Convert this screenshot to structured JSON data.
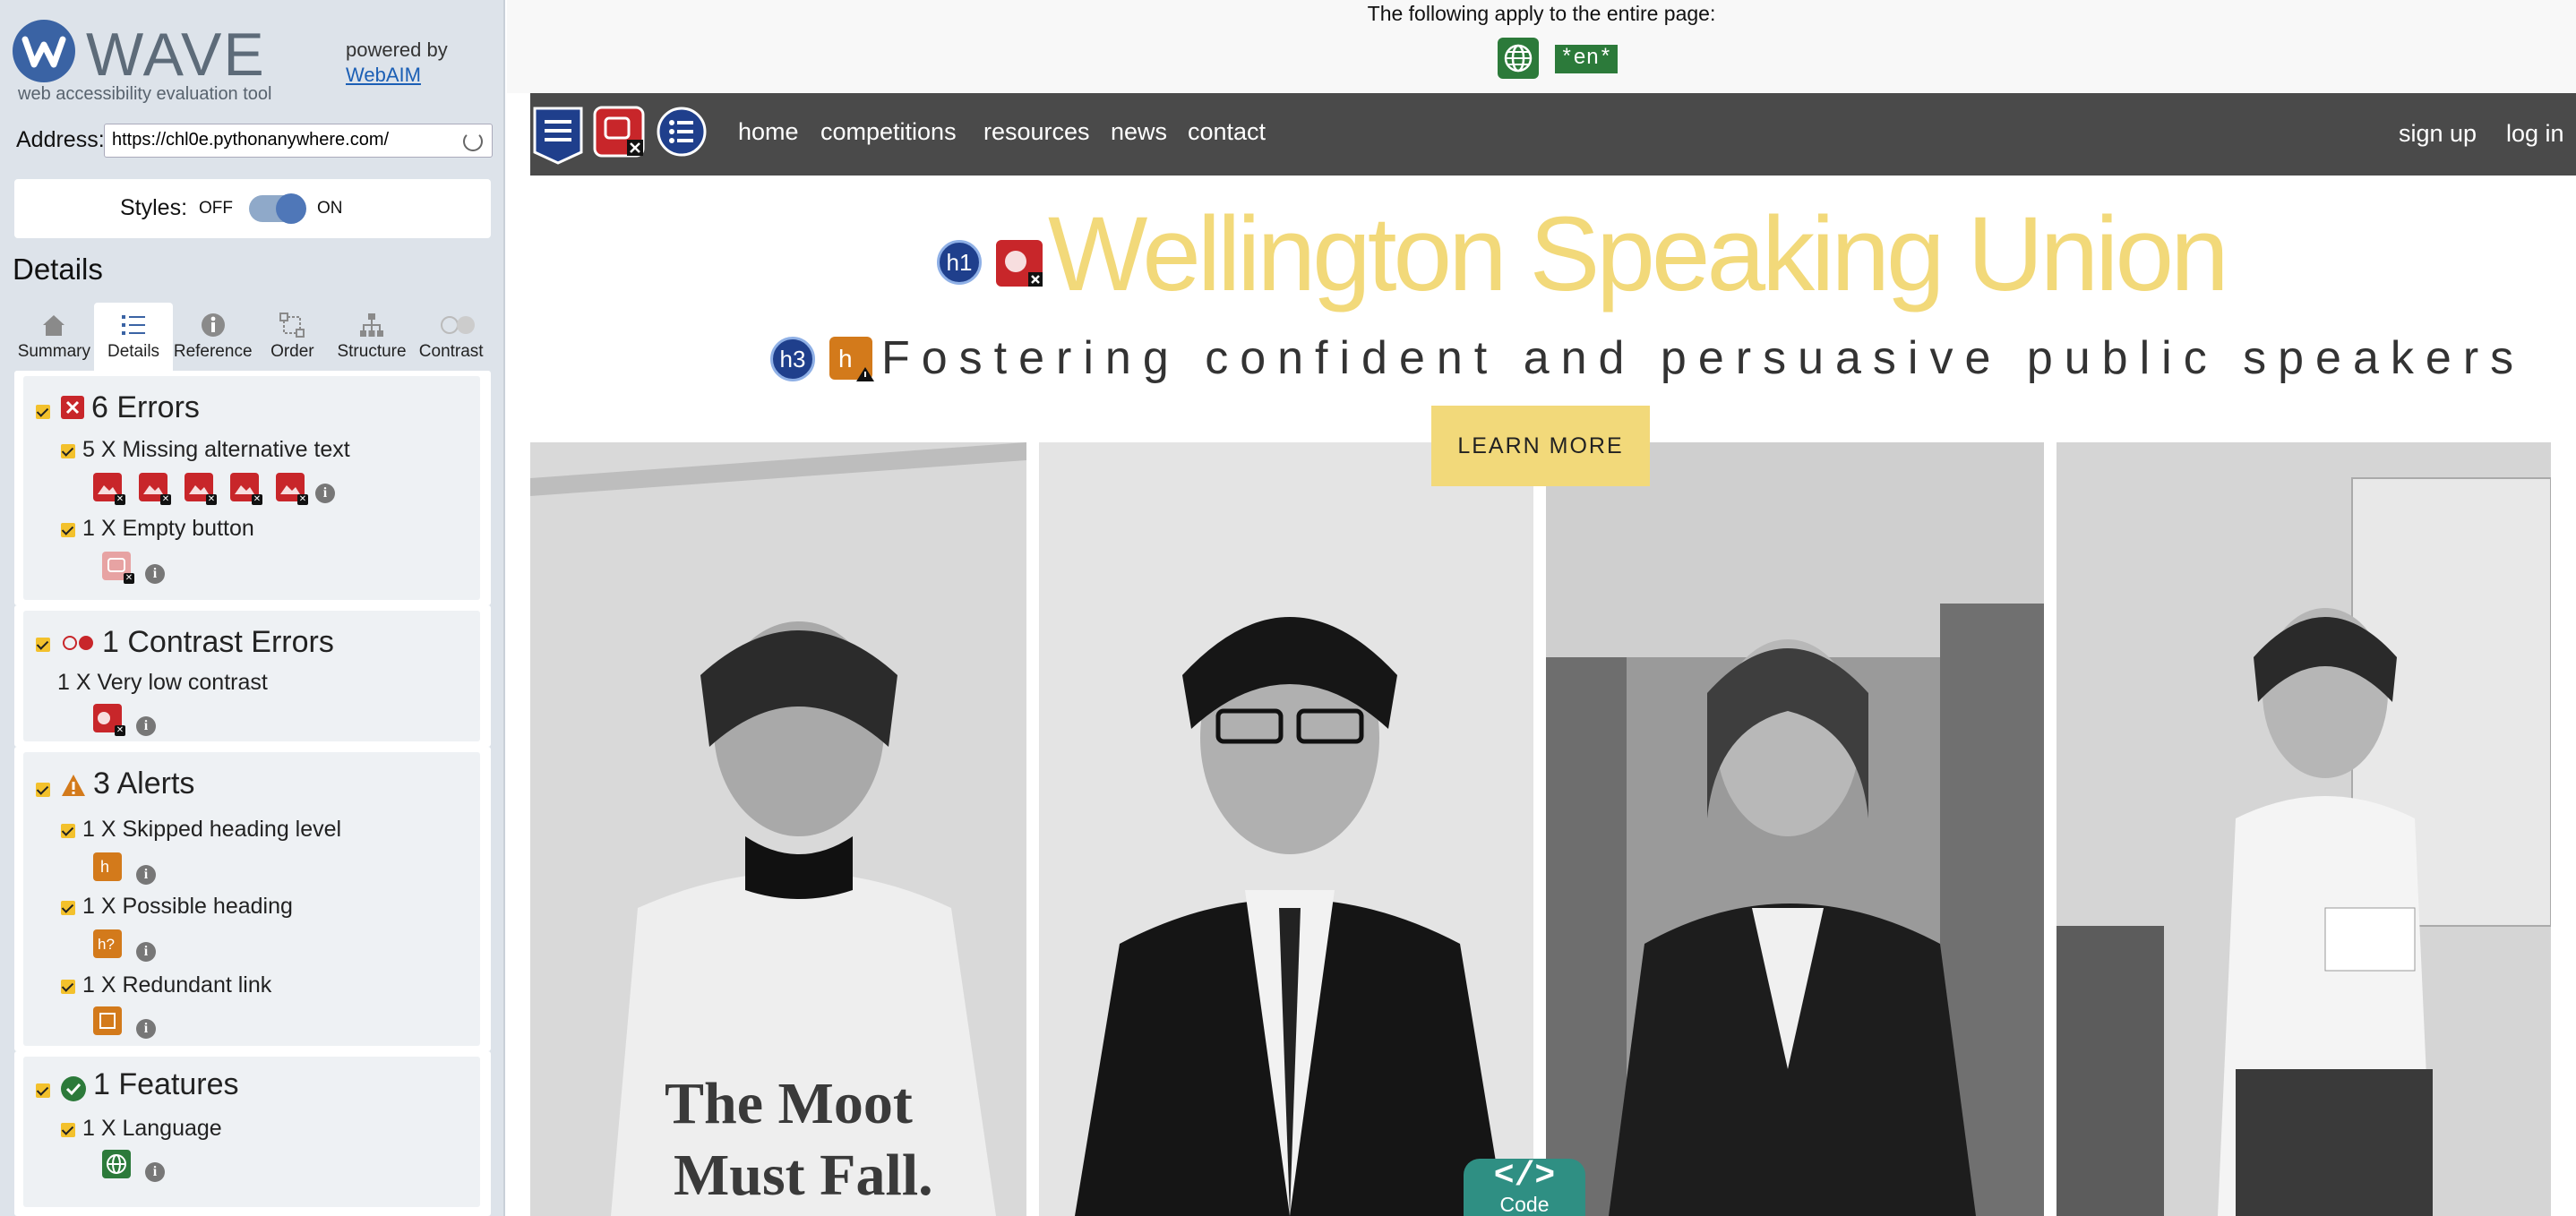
{
  "wave": {
    "brand": "WAVE",
    "tagline": "web accessibility evaluation tool",
    "powered_by": "powered by",
    "powered_link": "WebAIM",
    "address_label": "Address:",
    "address_value": "https://chl0e.pythonanywhere.com/",
    "styles_label": "Styles:",
    "styles_off": "OFF",
    "styles_on": "ON",
    "details_title": "Details",
    "tabs": [
      {
        "label": "Summary",
        "icon": "home-icon"
      },
      {
        "label": "Details",
        "icon": "list-icon",
        "active": true
      },
      {
        "label": "Reference",
        "icon": "info-icon"
      },
      {
        "label": "Order",
        "icon": "order-icon"
      },
      {
        "label": "Structure",
        "icon": "structure-icon"
      },
      {
        "label": "Contrast",
        "icon": "contrast-icon"
      }
    ],
    "errors": {
      "title": "6 Errors",
      "items": [
        {
          "label": "5 X Missing alternative text",
          "count": 5
        },
        {
          "label": "1 X Empty button",
          "count": 1
        }
      ]
    },
    "contrast": {
      "title": "1 Contrast Errors",
      "items": [
        {
          "label": "1 X Very low contrast",
          "count": 1
        }
      ]
    },
    "alerts": {
      "title": "3 Alerts",
      "items": [
        {
          "label": "1 X Skipped heading level",
          "count": 1
        },
        {
          "label": "1 X Possible heading",
          "count": 1
        },
        {
          "label": "1 X Redundant link",
          "count": 1
        }
      ]
    },
    "features": {
      "title": "1 Features",
      "items": [
        {
          "label": "1 X Language",
          "count": 1
        }
      ]
    },
    "colors": {
      "error": "#c8262a",
      "alert": "#d37a1b",
      "feature": "#2c7a3a",
      "structure": "#1f3f8c",
      "checkbox": "#f3c12c"
    }
  },
  "site": {
    "page_notice": "The following apply to the entire page:",
    "lang_tag": "*en*",
    "nav": [
      "home",
      "competitions",
      "resources",
      "news",
      "contact"
    ],
    "nav_right": [
      "sign up",
      "log in"
    ],
    "title": "Wellington Speaking Union",
    "subtitle": "Fostering confident and persuasive public speakers",
    "h1_label": "h1",
    "h3_label": "h3",
    "button": "LEARN MORE",
    "code_label": "Code",
    "code_glyph": "</>",
    "title_color": "#f2d97a",
    "nav_color": "#4a4a4a"
  }
}
